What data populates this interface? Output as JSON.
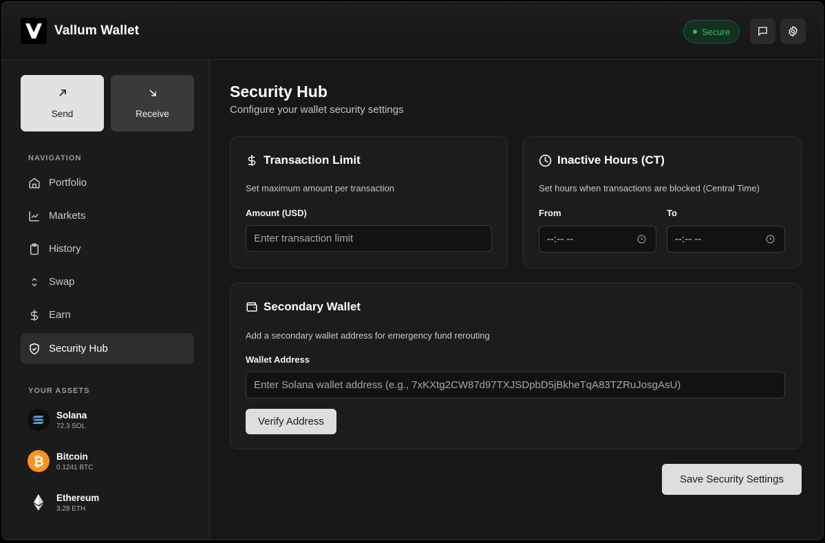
{
  "app": {
    "title": "Vallum Wallet"
  },
  "header": {
    "status_badge": "Secure",
    "status_color": "#34c26a",
    "icons": [
      "message-square-icon",
      "gear-icon"
    ]
  },
  "sidebar": {
    "actions": [
      {
        "label": "Send",
        "icon": "arrow-up-right-icon"
      },
      {
        "label": "Receive",
        "icon": "arrow-down-right-icon"
      }
    ],
    "nav_label": "NAVIGATION",
    "nav": [
      {
        "label": "Portfolio",
        "icon": "home-icon"
      },
      {
        "label": "Markets",
        "icon": "line-chart-icon"
      },
      {
        "label": "History",
        "icon": "clipboard-icon"
      },
      {
        "label": "Swap",
        "icon": "chevrons-up-down-icon"
      },
      {
        "label": "Earn",
        "icon": "dollar-icon"
      },
      {
        "label": "Security Hub",
        "icon": "shield-check-icon",
        "active": true
      }
    ],
    "assets_label": "YOUR ASSETS",
    "assets": [
      {
        "name": "Solana",
        "amount": "72.3 SOL",
        "icon": "solana-icon"
      },
      {
        "name": "Bitcoin",
        "amount": "0.1241 BTC",
        "icon": "bitcoin-icon"
      },
      {
        "name": "Ethereum",
        "amount": "3.28 ETH",
        "icon": "ethereum-icon"
      }
    ]
  },
  "main": {
    "title": "Security Hub",
    "subtitle": "Configure your wallet security settings",
    "transaction_limit": {
      "title": "Transaction Limit",
      "description": "Set maximum amount per transaction",
      "amount_label": "Amount (USD)",
      "amount_placeholder": "Enter transaction limit"
    },
    "inactive_hours": {
      "title": "Inactive Hours (CT)",
      "description": "Set hours when transactions are blocked (Central Time)",
      "from_label": "From",
      "to_label": "To",
      "from_value": "--:-- --",
      "to_value": "--:-- --"
    },
    "secondary_wallet": {
      "title": "Secondary Wallet",
      "description": "Add a secondary wallet address for emergency fund rerouting",
      "address_label": "Wallet Address",
      "address_placeholder": "Enter Solana wallet address (e.g., 7xKXtg2CW87d97TXJSDpbD5jBkheTqA83TZRuJosgAsU)",
      "verify_label": "Verify Address"
    },
    "save_label": "Save Security Settings"
  }
}
